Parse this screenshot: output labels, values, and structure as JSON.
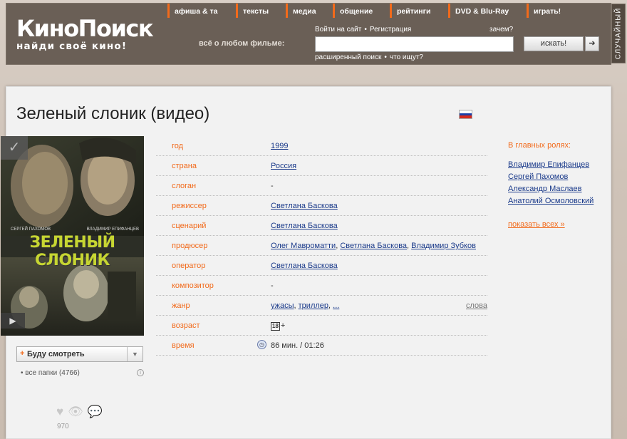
{
  "header": {
    "logo": "КиноПоиск",
    "tagline": "найди своё кино!",
    "nav": [
      {
        "label": "афиша & та"
      },
      {
        "label": "тексты"
      },
      {
        "label": "медиа"
      },
      {
        "label": "общение"
      },
      {
        "label": "рейтинги"
      },
      {
        "label": "DVD & Blu-Ray"
      },
      {
        "label": "играть!"
      }
    ],
    "search": {
      "label": "всё о любом фильме:",
      "login": "Войти на сайт",
      "register": "Регистрация",
      "why": "зачем?",
      "value": "",
      "button": "искать!",
      "go": "➔",
      "advanced": "расширенный поиск",
      "whats_searched": "что ищут?"
    },
    "random": "СЛУЧАЙНЫЙ"
  },
  "film": {
    "title": "Зеленый слоник (видео)",
    "flag_colors": [
      "#ffffff",
      "#1c3fa8",
      "#d52b1e"
    ],
    "poster": {
      "actor_left": "СЕРГЕЙ ПАХОМОВ",
      "actor_right": "ВЛАДИМИР ЕПИФАНЦЕВ",
      "title": "ЗЕЛЕНЫЙ СЛОНИК",
      "check_icon": "✓",
      "play_icon": "▶"
    },
    "watch_button": "Буду смотреть",
    "watch_plus": "+",
    "watch_arrow": "▼",
    "folders": "все папки (4766)",
    "info_icon": "i",
    "likes": "970",
    "social_icons": [
      "♥",
      "👁",
      "💬"
    ]
  },
  "info": {
    "year": {
      "key": "год",
      "value": "1999"
    },
    "country": {
      "key": "страна",
      "value": "Россия"
    },
    "slogan": {
      "key": "слоган",
      "value": "-"
    },
    "director": {
      "key": "режиссер",
      "value": "Светлана Баскова"
    },
    "writer": {
      "key": "сценарий",
      "value": "Светлана Баскова"
    },
    "producer": {
      "key": "продюсер",
      "values": [
        "Олег Мавроматти",
        "Светлана Баскова",
        "Владимир Зубков"
      ]
    },
    "operator": {
      "key": "оператор",
      "value": "Светлана Баскова"
    },
    "composer": {
      "key": "композитор",
      "value": "-"
    },
    "genre": {
      "key": "жанр",
      "values": [
        "ужасы",
        "триллер",
        "..."
      ],
      "words": "слова"
    },
    "age": {
      "key": "возраст",
      "badge": "18",
      "suffix": "+"
    },
    "time": {
      "key": "время",
      "value": "86 мин. / 01:26"
    }
  },
  "cast": {
    "title": "В главных ролях:",
    "actors": [
      "Владимир Епифанцев",
      "Сергей Пахомов",
      "Александр Маслаев",
      "Анатолий Осмоловский"
    ],
    "show_all": "показать всех »"
  }
}
